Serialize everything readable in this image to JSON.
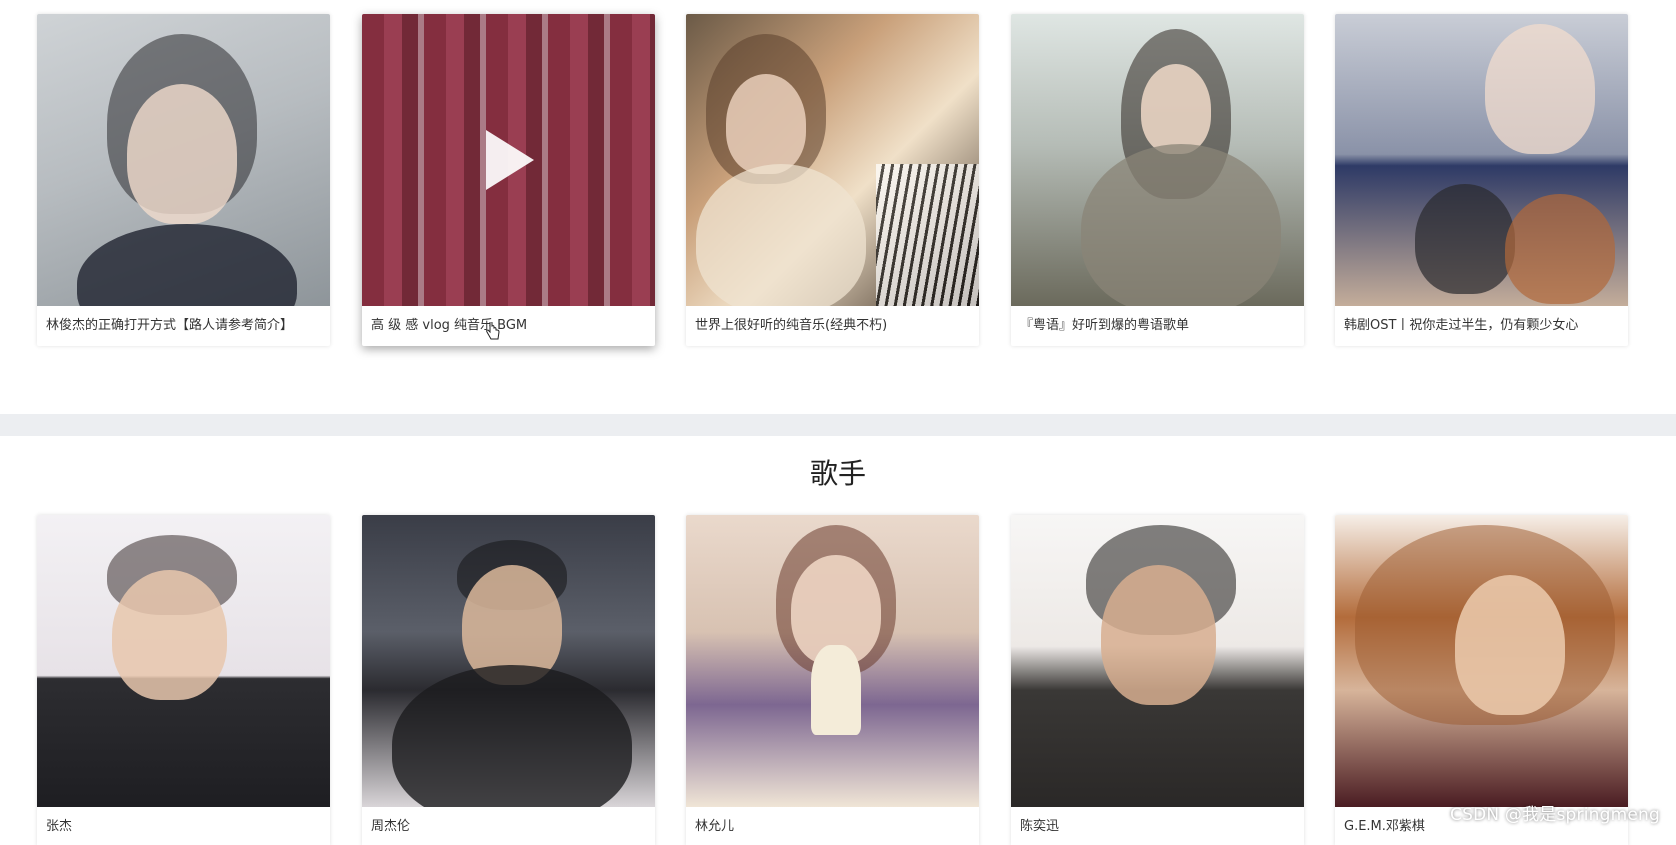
{
  "playlists": [
    {
      "title": "林俊杰的正确打开方式【路人请参考简介】"
    },
    {
      "title": "高 级 感 vlog 纯音乐 BGM"
    },
    {
      "title": "世界上很好听的纯音乐(经典不朽)"
    },
    {
      "title": "『粤语』好听到爆的粤语歌单"
    },
    {
      "title": "韩剧OST丨祝你走过半生，仍有颗少女心"
    }
  ],
  "singers_section": {
    "heading": "歌手",
    "items": [
      {
        "name": "张杰"
      },
      {
        "name": "周杰伦"
      },
      {
        "name": "林允儿"
      },
      {
        "name": "陈奕迅"
      },
      {
        "name": "G.E.M.邓紫棋"
      }
    ]
  },
  "watermark": "CSDN @我是springmeng",
  "colors": {
    "divider": "#eceef1",
    "caption_text": "#333333"
  },
  "icons": {
    "play": "play-icon",
    "cursor": "hand-cursor-icon"
  }
}
